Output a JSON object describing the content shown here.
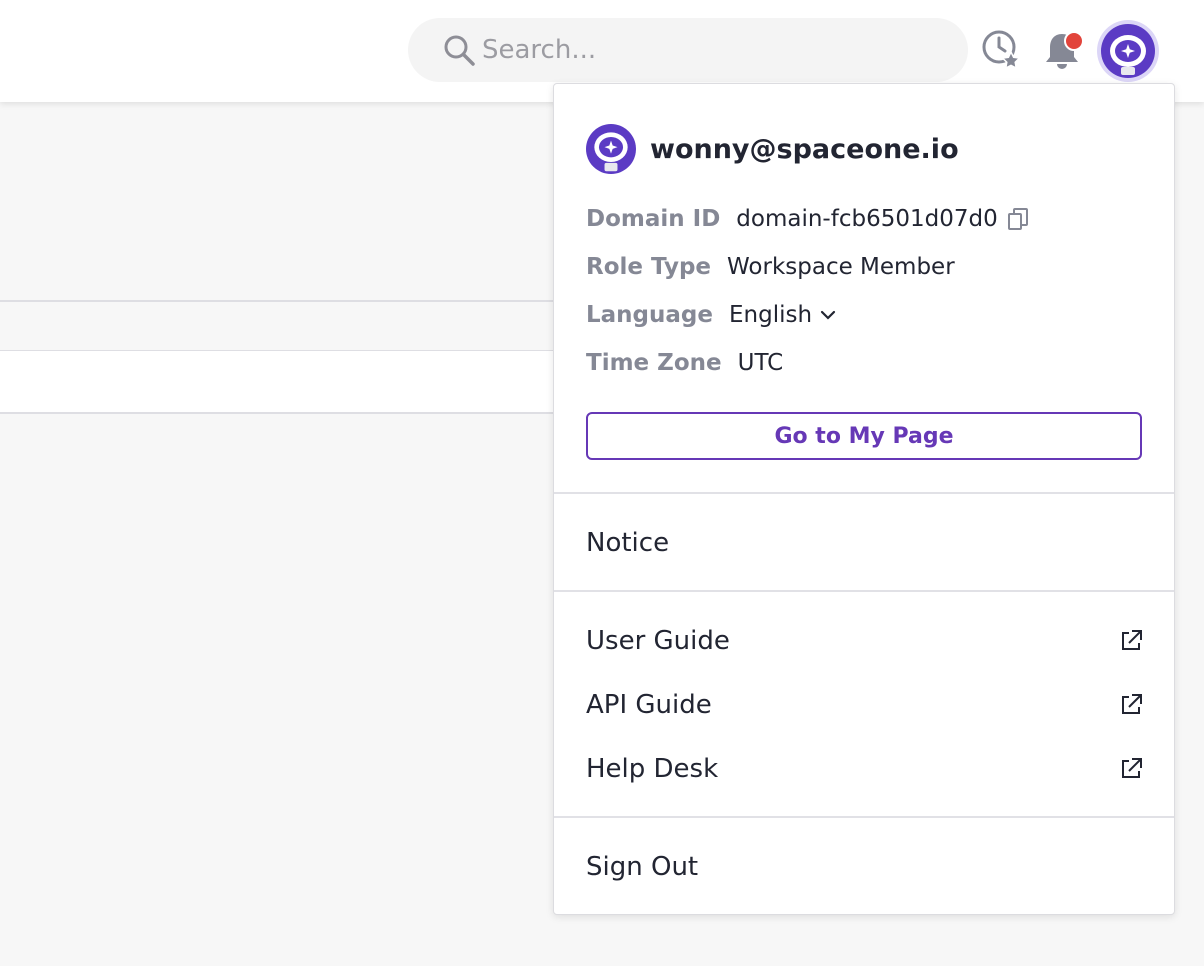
{
  "topbar": {
    "search": {
      "placeholder": "Search..."
    },
    "icons": [
      "search-icon",
      "recent-favorites-icon",
      "bell-icon",
      "avatar"
    ]
  },
  "profile_menu": {
    "email": "wonny@spaceone.io",
    "info": [
      {
        "label": "Domain ID",
        "value": "domain-fcb6501d07d0"
      },
      {
        "label": "Role Type",
        "value": "Workspace Member"
      },
      {
        "label": "Language",
        "value": "English"
      },
      {
        "label": "Time Zone",
        "value": "UTC"
      }
    ],
    "my_page_button": "Go to My Page",
    "items": {
      "notice": "Notice",
      "user_guide": "User Guide",
      "api_guide": "API Guide",
      "help_desk": "Help Desk",
      "sign_out": "Sign Out"
    }
  },
  "colors": {
    "accent": "#6638b6",
    "notification_dot": "#e2443b",
    "label_gray": "#858895"
  }
}
